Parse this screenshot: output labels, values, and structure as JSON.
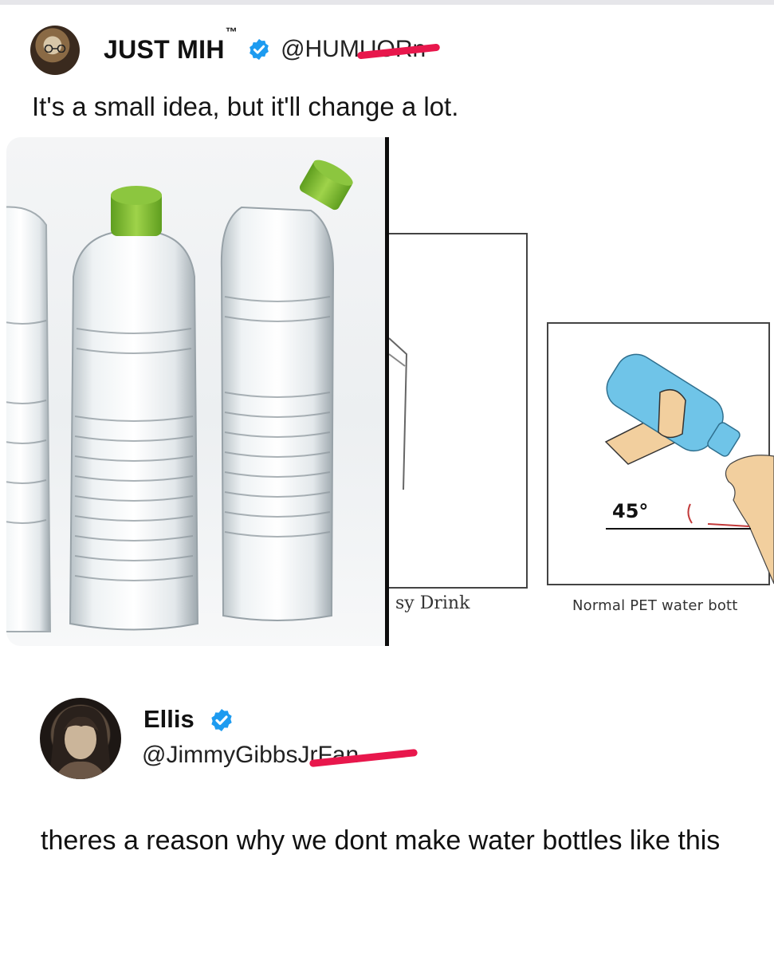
{
  "post": {
    "author_name": "JUST MIH",
    "author_tm": "™",
    "handle": "@HUMUORn",
    "text": "It's a small idea, but it'll change a lot.",
    "media": {
      "caption_left": "sy Drink",
      "caption_right": "Normal PET water bott",
      "angle_label": "45°"
    }
  },
  "reply": {
    "author_name": "Ellis",
    "handle": "@JimmyGibbsJrFan",
    "text": "theres a reason why we dont make water bottles like this"
  },
  "colors": {
    "verified_badge": "#1d9bf0",
    "redaction": "#e8174c",
    "cap_green": "#7cbf2e",
    "bottle_blue": "#6fc4e8"
  }
}
